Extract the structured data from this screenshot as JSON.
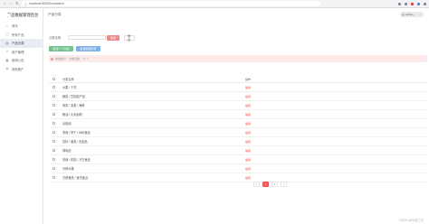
{
  "browser": {
    "url": "localhost:8082/food/admin"
  },
  "header": {
    "user_label": "admin"
  },
  "sidebar": {
    "brand_title": "产品数据管理后台",
    "items": [
      {
        "label": "首页",
        "icon": "home-icon"
      },
      {
        "label": "所有产品",
        "icon": "box-icon"
      },
      {
        "label": "产品分类",
        "icon": "folder-icon",
        "active": true
      },
      {
        "label": "用户管理",
        "icon": "user-icon"
      },
      {
        "label": "新闻公告",
        "icon": "doc-icon"
      },
      {
        "label": "其他账户",
        "icon": "gear-icon"
      }
    ]
  },
  "main": {
    "page_title": "产品分类",
    "filter_label": "分类名称",
    "filter_placeholder": "",
    "search_btn": "搜索",
    "reset_btn": "重置",
    "add_btn": "新增一个分类",
    "batch_delete_btn": "批量删除所有",
    "notice": "数据统计：分类总数：11 个"
  },
  "table": {
    "headers": [
      "分类名称",
      "操作"
    ],
    "rows": [
      {
        "name": "水果 / 干货",
        "op": "编辑"
      },
      {
        "name": "蔬菜 / 豆制品产品",
        "op": "编辑"
      },
      {
        "name": "肉类 / 禽蛋 / 海鲜",
        "op": "编辑"
      },
      {
        "name": "粮油 / 大米面粉",
        "op": "编辑"
      },
      {
        "name": "乳制品",
        "op": "编辑"
      },
      {
        "name": "零食 / 饼干 / 休闲食品",
        "op": "编辑"
      },
      {
        "name": "饮料 / 酒类 / 乳制品",
        "op": "编辑"
      },
      {
        "name": "调味品",
        "op": "编辑"
      },
      {
        "name": "熟食 / 烘焙 / 冷冻食品",
        "op": "编辑"
      },
      {
        "name": "冷鲜水果",
        "op": "编辑"
      },
      {
        "name": "方便食品 / 速冻面点",
        "op": "编辑"
      }
    ]
  },
  "pager": {
    "prev": "<",
    "pages": [
      "1",
      "2"
    ],
    "current": "1",
    "next": ">"
  },
  "watermark": "CSDN @毕设工坊"
}
